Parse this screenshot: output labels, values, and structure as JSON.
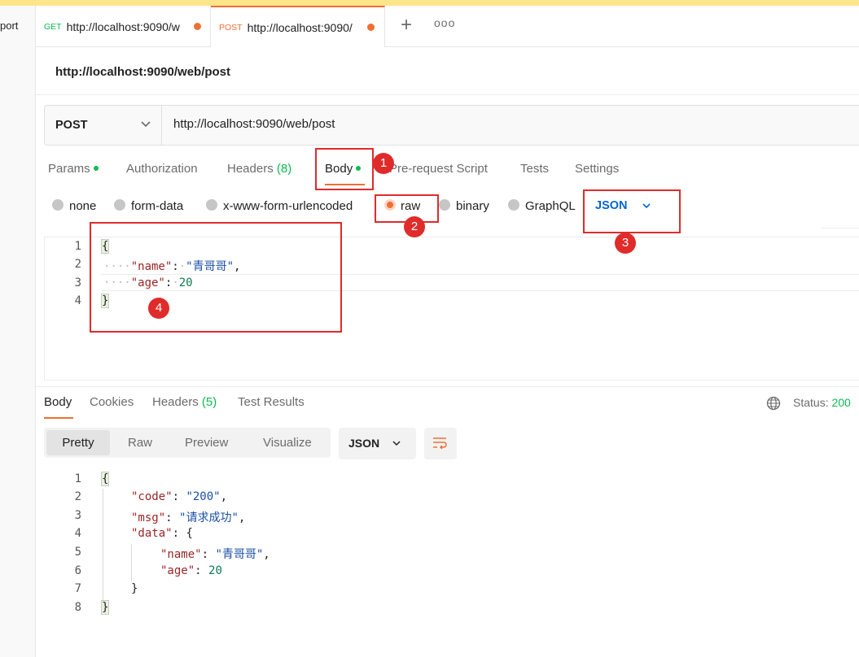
{
  "left_panel": {
    "label": "port"
  },
  "tabs": [
    {
      "method": "GET",
      "url": "http://localhost:9090/w",
      "method_color": "#0cbb52",
      "unsaved": true
    },
    {
      "method": "POST",
      "url": "http://localhost:9090/",
      "method_color": "#ef6f34",
      "unsaved": true,
      "active": true
    }
  ],
  "tab_actions": {
    "plus": "+",
    "more": "ooo"
  },
  "page_title": "http://localhost:9090/web/post",
  "request": {
    "method": "POST",
    "url": "http://localhost:9090/web/post"
  },
  "request_tabs": {
    "params": "Params",
    "authorization": "Authorization",
    "headers": "Headers",
    "headers_count": "(8)",
    "body": "Body",
    "prerequest": "Pre-request Script",
    "tests": "Tests",
    "settings": "Settings"
  },
  "body_types": {
    "none": "none",
    "form_data": "form-data",
    "urlencoded": "x-www-form-urlencoded",
    "raw": "raw",
    "binary": "binary",
    "graphql": "GraphQL",
    "selected": "raw",
    "raw_format": "JSON"
  },
  "request_body": {
    "line_numbers": [
      "1",
      "2",
      "3",
      "4"
    ],
    "open": "{",
    "indent": "····",
    "key1": "\"name\"",
    "colon": ":",
    "colon_ws": "·",
    "val1": "\"青哥哥\"",
    "comma": ",",
    "key2": "\"age\"",
    "val2": "20",
    "close": "}"
  },
  "response_tabs": {
    "body": "Body",
    "cookies": "Cookies",
    "headers": "Headers",
    "headers_count": "(5)",
    "test_results": "Test Results"
  },
  "status": {
    "label": "Status:",
    "value": "200"
  },
  "view_modes": {
    "pretty": "Pretty",
    "raw": "Raw",
    "preview": "Preview",
    "visualize": "Visualize",
    "format": "JSON"
  },
  "response_body": {
    "line_numbers": [
      "1",
      "2",
      "3",
      "4",
      "5",
      "6",
      "7",
      "8"
    ],
    "open": "{",
    "k_code": "\"code\"",
    "v_code": "\"200\"",
    "k_msg": "\"msg\"",
    "v_msg": "\"请求成功\"",
    "k_data": "\"data\"",
    "data_open": "{",
    "k_name": "\"name\"",
    "v_name": "\"青哥哥\"",
    "k_age": "\"age\"",
    "v_age": "20",
    "data_close": "}",
    "close": "}",
    "colon": ": ",
    "comma": ","
  },
  "annotations": [
    "1",
    "2",
    "3",
    "4"
  ],
  "colors": {
    "accent": "#ef6f34",
    "green": "#0cbb52",
    "annotation": "#e02b2b",
    "link_blue": "#0265d2",
    "json_key": "#9a2526",
    "json_string": "#1a4ea5",
    "json_number": "#0e7a52"
  },
  "icons": {
    "method_dropdown": "chevron-down-icon",
    "format_dropdown": "chevron-down-icon",
    "globe": "globe-icon",
    "wrap": "wrap-lines-icon",
    "unsaved": "dot-icon"
  }
}
